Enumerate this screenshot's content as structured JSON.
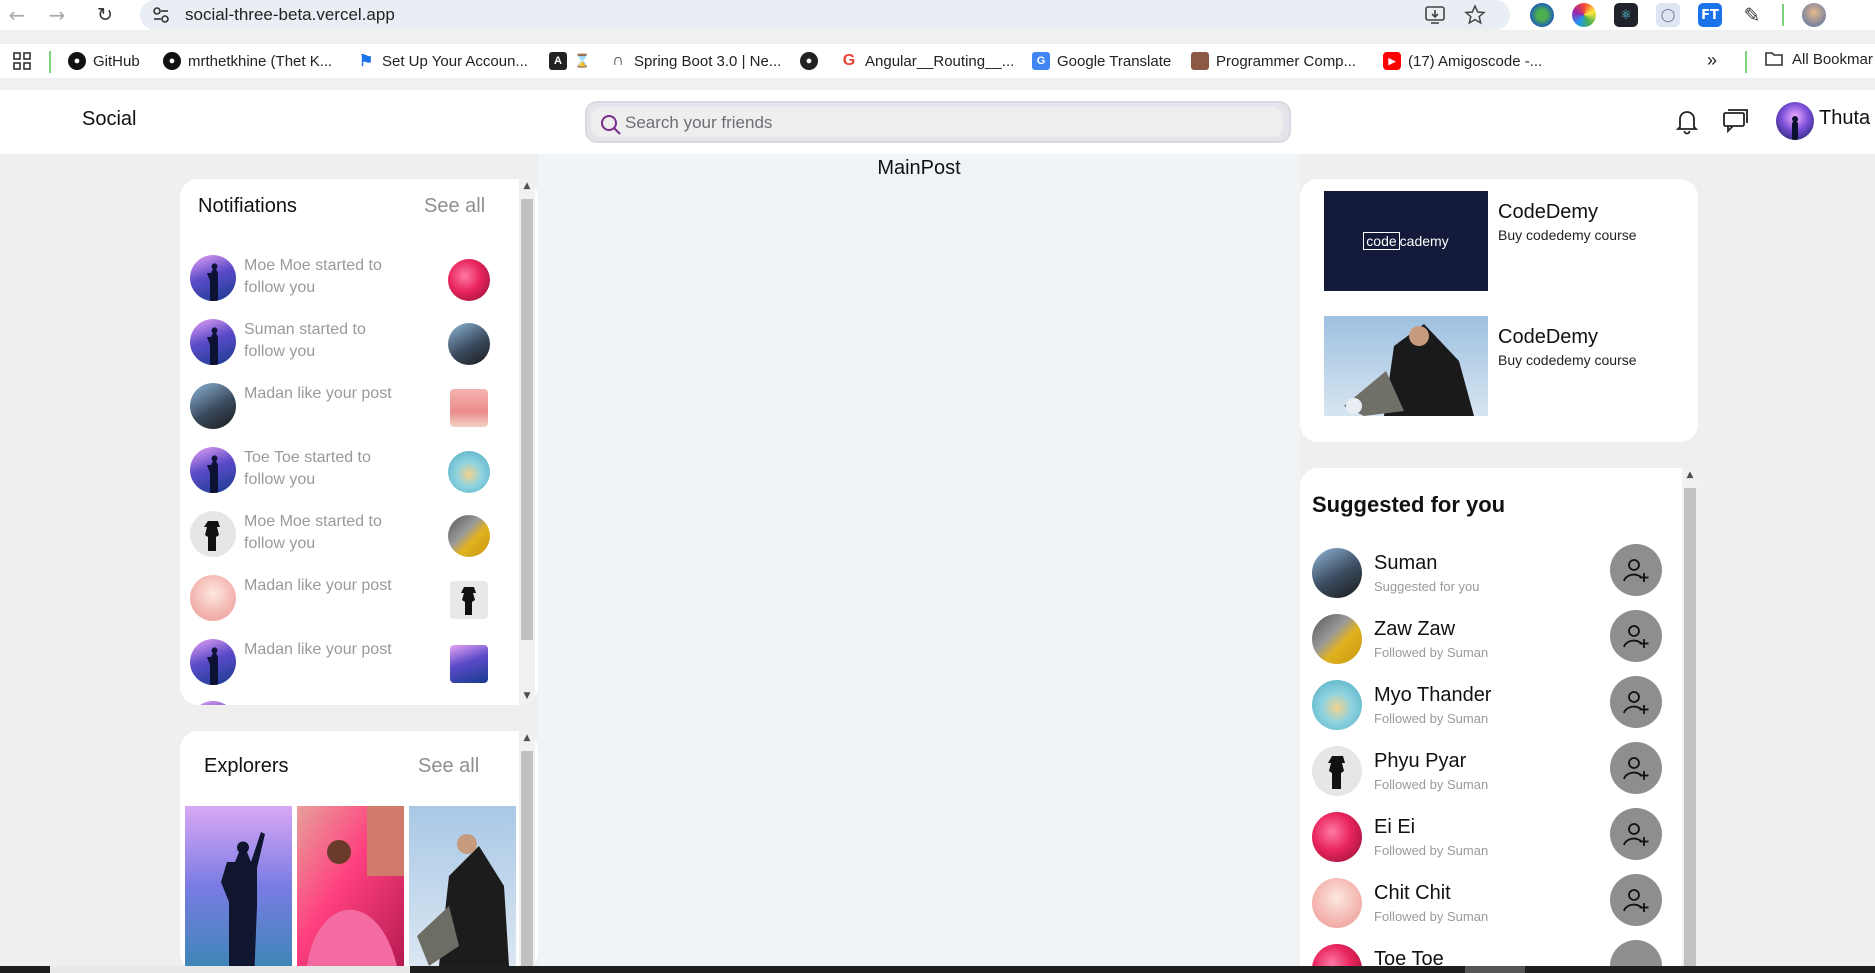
{
  "browser": {
    "url": "social-three-beta.vercel.app",
    "bookmarks": [
      {
        "label": "GitHub",
        "icon": "github-icon",
        "color": "#111111"
      },
      {
        "label": "mrthetkhine (Thet K...",
        "icon": "github-icon",
        "color": "#111111"
      },
      {
        "label": "Set Up Your Accoun...",
        "icon": "flag-icon",
        "color": "#1a73e8"
      },
      {
        "label": "",
        "icon": "angular-icon",
        "color": "#222222"
      },
      {
        "label": "Spring Boot 3.0 | Ne...",
        "icon": "bookmark-icon",
        "color": "#333333"
      },
      {
        "label": "",
        "icon": "globe-icon",
        "color": "#222222"
      },
      {
        "label": "Angular__Routing__...",
        "icon": "google-icon",
        "color": "#ea4335"
      },
      {
        "label": "Google Translate",
        "icon": "translate-icon",
        "color": "#4285f4"
      },
      {
        "label": "Programmer Comp...",
        "icon": "profile-icon",
        "color": "#8a5a44"
      },
      {
        "label": "(17) Amigoscode -...",
        "icon": "youtube-icon",
        "color": "#ff0000"
      }
    ],
    "all_bookmarks": "All Bookmar"
  },
  "header": {
    "logo": "Social",
    "search_placeholder": "Search your friends",
    "user_name": "Thuta"
  },
  "center": {
    "title": "MainPost"
  },
  "notifications": {
    "title": "Notifiations",
    "see_all": "See all",
    "items": [
      {
        "text": "Moe Moe started to follow you",
        "avatar": "blue",
        "thumb": "pink",
        "thumb_shape": "circle"
      },
      {
        "text": "Suman started to follow you",
        "avatar": "blue",
        "thumb": "teal",
        "thumb_shape": "circle"
      },
      {
        "text": "Madan like your post",
        "avatar": "teal",
        "thumb": "rose",
        "thumb_shape": "square"
      },
      {
        "text": "Toe Toe started to follow you",
        "avatar": "blue",
        "thumb": "sky",
        "thumb_shape": "circle"
      },
      {
        "text": "Moe Moe started to follow you",
        "avatar": "mono",
        "thumb": "yellow",
        "thumb_shape": "circle"
      },
      {
        "text": "Madan like your post",
        "avatar": "rose",
        "thumb": "mono",
        "thumb_shape": "square"
      },
      {
        "text": "Madan like your post",
        "avatar": "blue",
        "thumb": "blue",
        "thumb_shape": "square"
      }
    ]
  },
  "explorers": {
    "title": "Explorers",
    "see_all": "See all"
  },
  "ads": [
    {
      "title": "CodeDemy",
      "desc": "Buy codedemy course",
      "logo_a": "code",
      "logo_b": "cademy"
    },
    {
      "title": "CodeDemy",
      "desc": "Buy codedemy course"
    }
  ],
  "suggestions": {
    "title": "Suggested for you",
    "items": [
      {
        "name": "Suman",
        "sub": "Suggested for you",
        "avatar": "teal"
      },
      {
        "name": "Zaw Zaw",
        "sub": "Followed by Suman",
        "avatar": "yellow"
      },
      {
        "name": "Myo Thander",
        "sub": "Followed by Suman",
        "avatar": "sky"
      },
      {
        "name": "Phyu Pyar",
        "sub": "Followed by Suman",
        "avatar": "mono"
      },
      {
        "name": "Ei Ei",
        "sub": "Followed by Suman",
        "avatar": "pink"
      },
      {
        "name": "Chit Chit",
        "sub": "Followed by Suman",
        "avatar": "rose"
      },
      {
        "name": "Toe Toe",
        "sub": "",
        "avatar": "pink"
      }
    ]
  },
  "colors": {
    "follow_button": "#8e8e8e",
    "ad_banner": "#141b3a"
  }
}
